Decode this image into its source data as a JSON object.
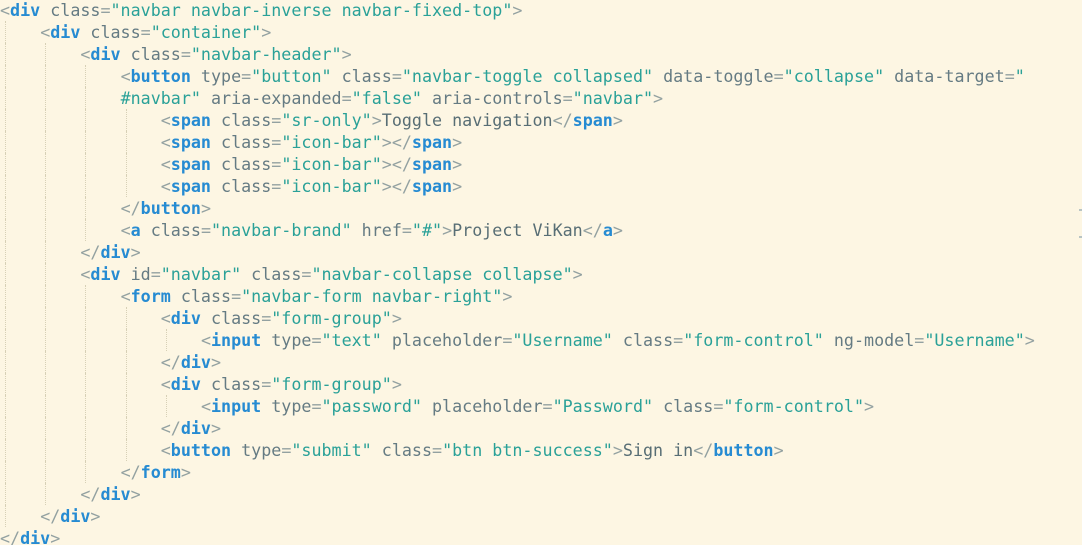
{
  "theme": {
    "background": "#fdf6e3",
    "punctuation": "#93a1a1",
    "tag": "#268bd2",
    "attribute": "#657b83",
    "string": "#2aa198",
    "text": "#586e75"
  },
  "code": {
    "indent_unit": "    ",
    "lines": [
      {
        "indent": 0,
        "tokens": [
          [
            "p",
            "<"
          ],
          [
            "t",
            "div"
          ],
          [
            "a",
            " class"
          ],
          [
            "p",
            "="
          ],
          [
            "s",
            "\"navbar navbar-inverse navbar-fixed-top\""
          ],
          [
            "p",
            ">"
          ]
        ]
      },
      {
        "indent": 1,
        "tokens": [
          [
            "p",
            "<"
          ],
          [
            "t",
            "div"
          ],
          [
            "a",
            " class"
          ],
          [
            "p",
            "="
          ],
          [
            "s",
            "\"container\""
          ],
          [
            "p",
            ">"
          ]
        ]
      },
      {
        "indent": 2,
        "tokens": [
          [
            "p",
            "<"
          ],
          [
            "t",
            "div"
          ],
          [
            "a",
            " class"
          ],
          [
            "p",
            "="
          ],
          [
            "s",
            "\"navbar-header\""
          ],
          [
            "p",
            ">"
          ]
        ]
      },
      {
        "indent": 3,
        "tokens": [
          [
            "p",
            "<"
          ],
          [
            "t",
            "button"
          ],
          [
            "a",
            " type"
          ],
          [
            "p",
            "="
          ],
          [
            "s",
            "\"button\""
          ],
          [
            "a",
            " class"
          ],
          [
            "p",
            "="
          ],
          [
            "s",
            "\"navbar-toggle collapsed\""
          ],
          [
            "a",
            " data-toggle"
          ],
          [
            "p",
            "="
          ],
          [
            "s",
            "\"collapse\""
          ],
          [
            "a",
            " data-target"
          ],
          [
            "p",
            "="
          ],
          [
            "s",
            "\""
          ]
        ]
      },
      {
        "indent": 3,
        "tokens": [
          [
            "s",
            "#navbar\""
          ],
          [
            "a",
            " aria-expanded"
          ],
          [
            "p",
            "="
          ],
          [
            "s",
            "\"false\""
          ],
          [
            "a",
            " aria-controls"
          ],
          [
            "p",
            "="
          ],
          [
            "s",
            "\"navbar\""
          ],
          [
            "p",
            ">"
          ]
        ]
      },
      {
        "indent": 4,
        "tokens": [
          [
            "p",
            "<"
          ],
          [
            "t",
            "span"
          ],
          [
            "a",
            " class"
          ],
          [
            "p",
            "="
          ],
          [
            "s",
            "\"sr-only\""
          ],
          [
            "p",
            ">"
          ],
          [
            "x",
            "Toggle navigation"
          ],
          [
            "p",
            "</"
          ],
          [
            "t",
            "span"
          ],
          [
            "p",
            ">"
          ]
        ]
      },
      {
        "indent": 4,
        "tokens": [
          [
            "p",
            "<"
          ],
          [
            "t",
            "span"
          ],
          [
            "a",
            " class"
          ],
          [
            "p",
            "="
          ],
          [
            "s",
            "\"icon-bar\""
          ],
          [
            "p",
            "></"
          ],
          [
            "t",
            "span"
          ],
          [
            "p",
            ">"
          ]
        ]
      },
      {
        "indent": 4,
        "tokens": [
          [
            "p",
            "<"
          ],
          [
            "t",
            "span"
          ],
          [
            "a",
            " class"
          ],
          [
            "p",
            "="
          ],
          [
            "s",
            "\"icon-bar\""
          ],
          [
            "p",
            "></"
          ],
          [
            "t",
            "span"
          ],
          [
            "p",
            ">"
          ]
        ]
      },
      {
        "indent": 4,
        "tokens": [
          [
            "p",
            "<"
          ],
          [
            "t",
            "span"
          ],
          [
            "a",
            " class"
          ],
          [
            "p",
            "="
          ],
          [
            "s",
            "\"icon-bar\""
          ],
          [
            "p",
            "></"
          ],
          [
            "t",
            "span"
          ],
          [
            "p",
            ">"
          ]
        ]
      },
      {
        "indent": 3,
        "tokens": [
          [
            "p",
            "</"
          ],
          [
            "t",
            "button"
          ],
          [
            "p",
            ">"
          ]
        ]
      },
      {
        "indent": 3,
        "tokens": [
          [
            "p",
            "<"
          ],
          [
            "t",
            "a"
          ],
          [
            "a",
            " class"
          ],
          [
            "p",
            "="
          ],
          [
            "s",
            "\"navbar-brand\""
          ],
          [
            "a",
            " href"
          ],
          [
            "p",
            "="
          ],
          [
            "s",
            "\"#\""
          ],
          [
            "p",
            ">"
          ],
          [
            "x",
            "Project ViKan"
          ],
          [
            "p",
            "</"
          ],
          [
            "t",
            "a"
          ],
          [
            "p",
            ">"
          ]
        ]
      },
      {
        "indent": 2,
        "tokens": [
          [
            "p",
            "</"
          ],
          [
            "t",
            "div"
          ],
          [
            "p",
            ">"
          ]
        ]
      },
      {
        "indent": 2,
        "tokens": [
          [
            "p",
            "<"
          ],
          [
            "t",
            "div"
          ],
          [
            "a",
            " id"
          ],
          [
            "p",
            "="
          ],
          [
            "s",
            "\"navbar\""
          ],
          [
            "a",
            " class"
          ],
          [
            "p",
            "="
          ],
          [
            "s",
            "\"navbar-collapse collapse\""
          ],
          [
            "p",
            ">"
          ]
        ]
      },
      {
        "indent": 3,
        "tokens": [
          [
            "p",
            "<"
          ],
          [
            "t",
            "form"
          ],
          [
            "a",
            " class"
          ],
          [
            "p",
            "="
          ],
          [
            "s",
            "\"navbar-form navbar-right\""
          ],
          [
            "p",
            ">"
          ]
        ]
      },
      {
        "indent": 4,
        "tokens": [
          [
            "p",
            "<"
          ],
          [
            "t",
            "div"
          ],
          [
            "a",
            " class"
          ],
          [
            "p",
            "="
          ],
          [
            "s",
            "\"form-group\""
          ],
          [
            "p",
            ">"
          ]
        ]
      },
      {
        "indent": 5,
        "tokens": [
          [
            "p",
            "<"
          ],
          [
            "t",
            "input"
          ],
          [
            "a",
            " type"
          ],
          [
            "p",
            "="
          ],
          [
            "s",
            "\"text\""
          ],
          [
            "a",
            " placeholder"
          ],
          [
            "p",
            "="
          ],
          [
            "s",
            "\"Username\""
          ],
          [
            "a",
            " class"
          ],
          [
            "p",
            "="
          ],
          [
            "s",
            "\"form-control\""
          ],
          [
            "a",
            " ng-model"
          ],
          [
            "p",
            "="
          ],
          [
            "s",
            "\"Username\""
          ],
          [
            "p",
            ">"
          ]
        ]
      },
      {
        "indent": 4,
        "tokens": [
          [
            "p",
            "</"
          ],
          [
            "t",
            "div"
          ],
          [
            "p",
            ">"
          ]
        ]
      },
      {
        "indent": 4,
        "tokens": [
          [
            "p",
            "<"
          ],
          [
            "t",
            "div"
          ],
          [
            "a",
            " class"
          ],
          [
            "p",
            "="
          ],
          [
            "s",
            "\"form-group\""
          ],
          [
            "p",
            ">"
          ]
        ]
      },
      {
        "indent": 5,
        "tokens": [
          [
            "p",
            "<"
          ],
          [
            "t",
            "input"
          ],
          [
            "a",
            " type"
          ],
          [
            "p",
            "="
          ],
          [
            "s",
            "\"password\""
          ],
          [
            "a",
            " placeholder"
          ],
          [
            "p",
            "="
          ],
          [
            "s",
            "\"Password\""
          ],
          [
            "a",
            " class"
          ],
          [
            "p",
            "="
          ],
          [
            "s",
            "\"form-control\""
          ],
          [
            "p",
            ">"
          ]
        ]
      },
      {
        "indent": 4,
        "tokens": [
          [
            "p",
            "</"
          ],
          [
            "t",
            "div"
          ],
          [
            "p",
            ">"
          ]
        ]
      },
      {
        "indent": 4,
        "tokens": [
          [
            "p",
            "<"
          ],
          [
            "t",
            "button"
          ],
          [
            "a",
            " type"
          ],
          [
            "p",
            "="
          ],
          [
            "s",
            "\"submit\""
          ],
          [
            "a",
            " class"
          ],
          [
            "p",
            "="
          ],
          [
            "s",
            "\"btn btn-success\""
          ],
          [
            "p",
            ">"
          ],
          [
            "x",
            "Sign in"
          ],
          [
            "p",
            "</"
          ],
          [
            "t",
            "button"
          ],
          [
            "p",
            ">"
          ]
        ]
      },
      {
        "indent": 3,
        "tokens": [
          [
            "p",
            "</"
          ],
          [
            "t",
            "form"
          ],
          [
            "p",
            ">"
          ]
        ]
      },
      {
        "indent": 2,
        "tokens": [
          [
            "p",
            "</"
          ],
          [
            "t",
            "div"
          ],
          [
            "p",
            ">"
          ]
        ]
      },
      {
        "indent": 1,
        "tokens": [
          [
            "p",
            "</"
          ],
          [
            "t",
            "div"
          ],
          [
            "p",
            ">"
          ]
        ]
      },
      {
        "indent": 0,
        "tokens": [
          [
            "p",
            "</"
          ],
          [
            "t",
            "div"
          ],
          [
            "p",
            ">"
          ]
        ]
      }
    ]
  }
}
